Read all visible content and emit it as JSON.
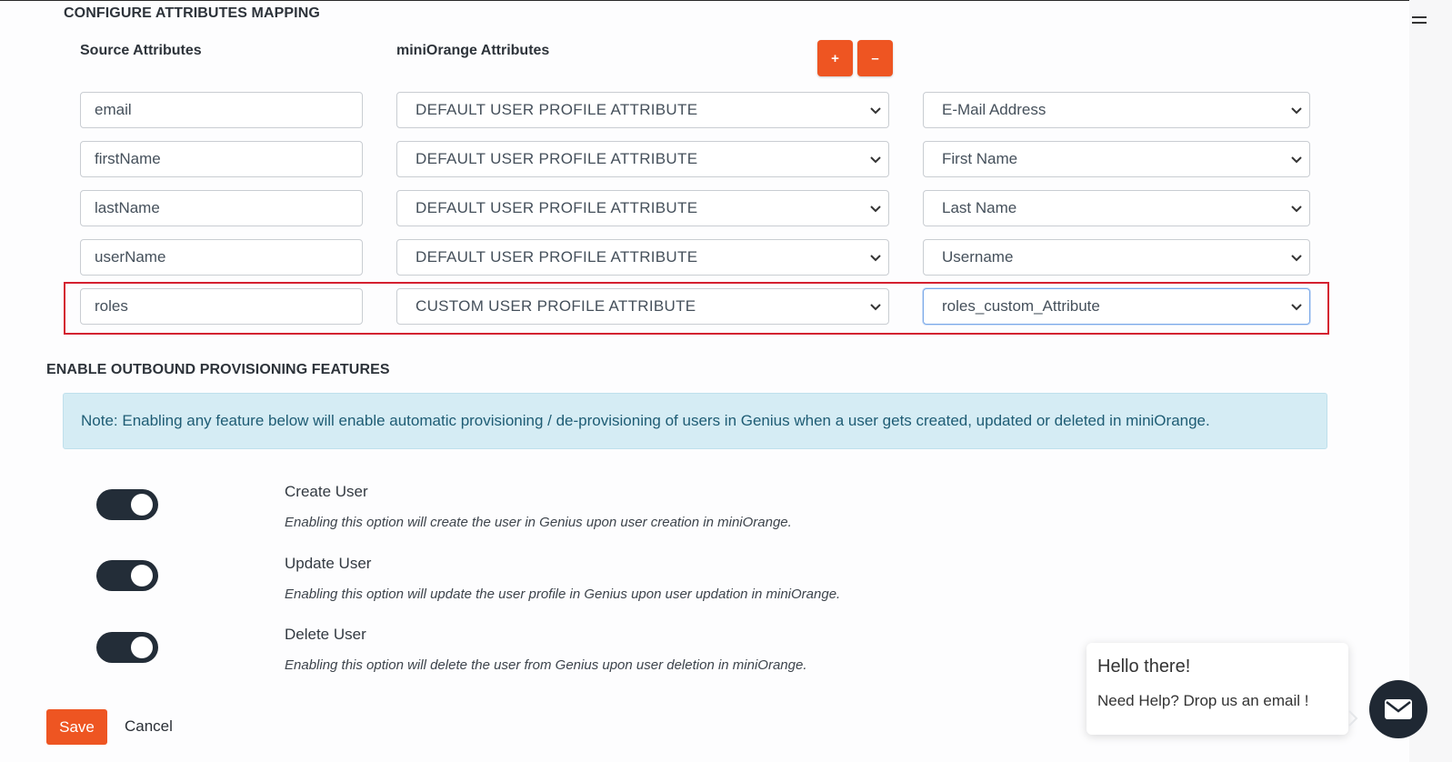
{
  "sections": {
    "mapping_title": "CONFIGURE ATTRIBUTES MAPPING",
    "provisioning_title": "ENABLE OUTBOUND PROVISIONING FEATURES"
  },
  "columns": {
    "source": "Source Attributes",
    "miniorange": "miniOrange Attributes"
  },
  "buttons": {
    "add": "+",
    "remove": "–",
    "save": "Save",
    "cancel": "Cancel"
  },
  "rows": [
    {
      "source": "email",
      "type": "DEFAULT USER PROFILE ATTRIBUTE",
      "attribute": "E-Mail Address"
    },
    {
      "source": "firstName",
      "type": "DEFAULT USER PROFILE ATTRIBUTE",
      "attribute": "First Name"
    },
    {
      "source": "lastName",
      "type": "DEFAULT USER PROFILE ATTRIBUTE",
      "attribute": "Last Name"
    },
    {
      "source": "userName",
      "type": "DEFAULT USER PROFILE ATTRIBUTE",
      "attribute": "Username"
    },
    {
      "source": "roles",
      "type": "CUSTOM USER PROFILE ATTRIBUTE",
      "attribute": "roles_custom_Attribute"
    }
  ],
  "note": "Note: Enabling any feature below will enable automatic provisioning / de-provisioning of users in Genius when a user gets created, updated or deleted in miniOrange.",
  "features": [
    {
      "title": "Create User",
      "desc": "Enabling this option will create the user in Genius upon user creation in miniOrange.",
      "enabled": true
    },
    {
      "title": "Update User",
      "desc": "Enabling this option will update the user profile in Genius upon user updation in miniOrange.",
      "enabled": true
    },
    {
      "title": "Delete User",
      "desc": "Enabling this option will delete the user from Genius upon user deletion in miniOrange.",
      "enabled": true
    }
  ],
  "chat": {
    "hello": "Hello there!",
    "help": "Need Help? Drop us an email !"
  },
  "colors": {
    "accent": "#ee5522",
    "highlight": "#d42030",
    "toggle_on": "#232d38",
    "note_bg": "#d5ecf4"
  },
  "icons": [
    "menu-icon",
    "chevron-down-icon",
    "mail-icon"
  ]
}
